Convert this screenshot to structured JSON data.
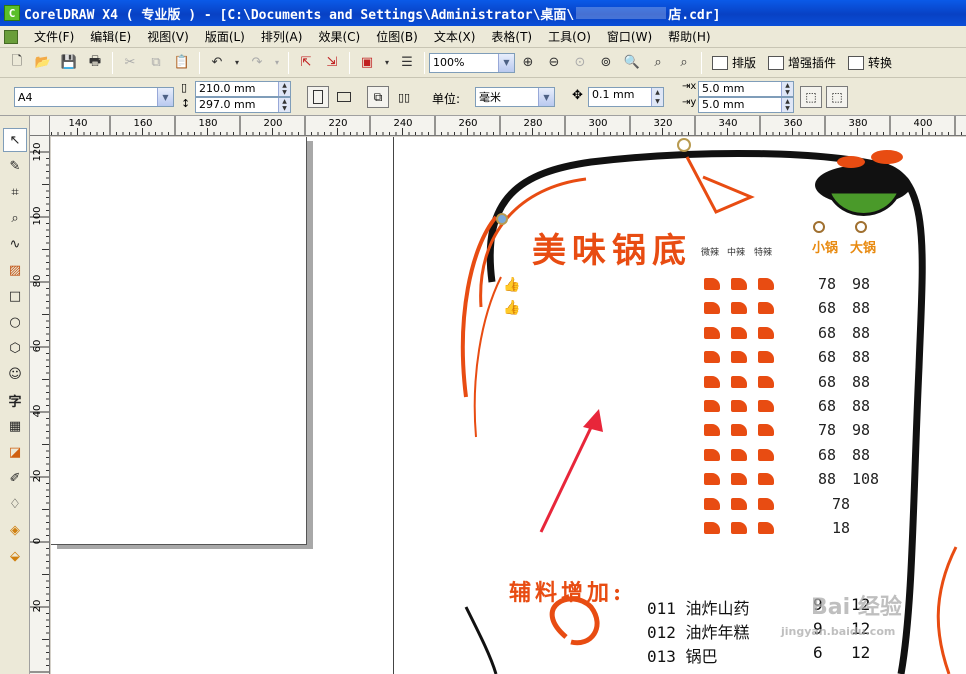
{
  "window": {
    "title_prefix": "CorelDRAW X4 ( 专业版 ) - [C:\\Documents and Settings\\Administrator\\桌面\\",
    "title_suffix": "店.cdr]"
  },
  "menu": [
    "文件(F)",
    "编辑(E)",
    "视图(V)",
    "版面(L)",
    "排列(A)",
    "效果(C)",
    "位图(B)",
    "文本(X)",
    "表格(T)",
    "工具(O)",
    "窗口(W)",
    "帮助(H)"
  ],
  "toolbar": {
    "zoom": "100%",
    "buttons": [
      "排版",
      "增强插件",
      "转换"
    ]
  },
  "property_bar": {
    "page_size": "A4",
    "width": "210.0 mm",
    "height": "297.0 mm",
    "units_label": "单位:",
    "units": "毫米",
    "nudge": "0.1 mm",
    "dup_x": "5.0 mm",
    "dup_y": "5.0 mm"
  },
  "ruler": {
    "h_labels": [
      "140",
      "160",
      "180",
      "200",
      "220",
      "240",
      "260",
      "280",
      "300",
      "320",
      "340",
      "360",
      "380",
      "400"
    ],
    "v_labels": [
      "120",
      "100",
      "80",
      "60",
      "40",
      "20",
      "0",
      "20"
    ]
  },
  "toolbox": [
    "pick-tool-icon",
    "shape-tool-icon",
    "crop-tool-icon",
    "zoom-tool-icon",
    "freehand-tool-icon",
    "smart-fill-icon",
    "rectangle-tool-icon",
    "ellipse-tool-icon",
    "polygon-tool-icon",
    "basic-shapes-icon",
    "text-tool-icon",
    "table-tool-icon",
    "interactive-tool-icon",
    "eyedropper-icon",
    "outline-tool-icon",
    "fill-tool-icon",
    "interactive-fill-icon"
  ],
  "design": {
    "title": "美味锅底",
    "spice_levels": [
      "微辣",
      "中辣",
      "特辣"
    ],
    "sizes": [
      "小锅",
      "大锅"
    ],
    "prices": [
      [
        "78",
        "98"
      ],
      [
        "68",
        "88"
      ],
      [
        "68",
        "88"
      ],
      [
        "68",
        "88"
      ],
      [
        "68",
        "88"
      ],
      [
        "68",
        "88"
      ],
      [
        "78",
        "98"
      ],
      [
        "68",
        "88"
      ],
      [
        "88",
        "108"
      ],
      [
        "78",
        ""
      ],
      [
        "18",
        ""
      ]
    ],
    "extras_title": "辅料增加:",
    "extras": [
      {
        "name": "011 油炸山药",
        "small": "9",
        "large": "12"
      },
      {
        "name": "012 油炸年糕",
        "small": "9",
        "large": "12"
      },
      {
        "name": "013 锅巴",
        "small": "6",
        "large": "12"
      }
    ],
    "watermark": "Bai 经验",
    "watermark_url": "jingyan.baidu.com",
    "colors": {
      "accent": "#e84c12",
      "frame": "#111111",
      "arrow": "#e8263a",
      "pot": "#4a9a2a"
    }
  }
}
